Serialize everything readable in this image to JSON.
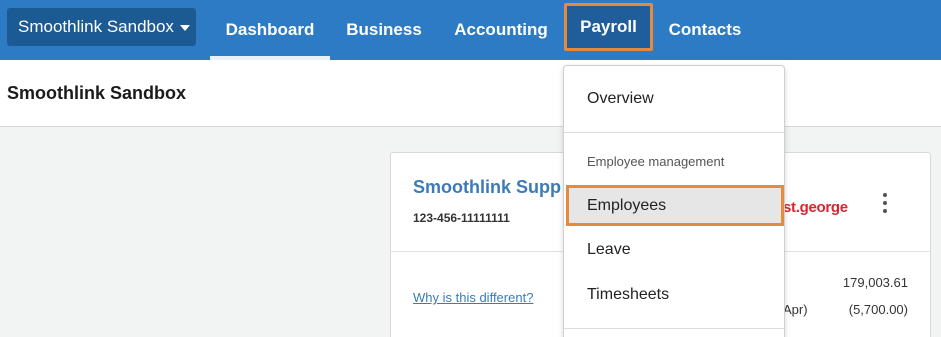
{
  "org_switcher": {
    "label": "Smoothlink Sandbox",
    "icon": "caret-down-icon"
  },
  "nav": {
    "tabs": [
      {
        "label": "Dashboard",
        "active": true
      },
      {
        "label": "Business"
      },
      {
        "label": "Accounting"
      },
      {
        "label": "Payroll",
        "highlighted": true
      },
      {
        "label": "Contacts"
      }
    ]
  },
  "page": {
    "title": "Smoothlink Sandbox"
  },
  "account_card": {
    "name": "Smoothlink Supp",
    "number": "123-456-11111111",
    "bank_logo": "st.george",
    "menu_icon": "more-vertical-icon",
    "why_link": "Why is this different?",
    "balance_1": "179,003.61",
    "balance_2_label": "Apr)",
    "balance_2": "(5,700.00)"
  },
  "payroll_menu": {
    "overview": "Overview",
    "section_header": "Employee management",
    "employees": "Employees",
    "leave": "Leave",
    "timesheets": "Timesheets"
  },
  "colors": {
    "nav_bg": "#2d7bc4",
    "org_button_bg": "#1c5a94",
    "highlight_outline": "#e88a3c",
    "link": "#3d7ab8",
    "bank_red": "#d6262f"
  }
}
